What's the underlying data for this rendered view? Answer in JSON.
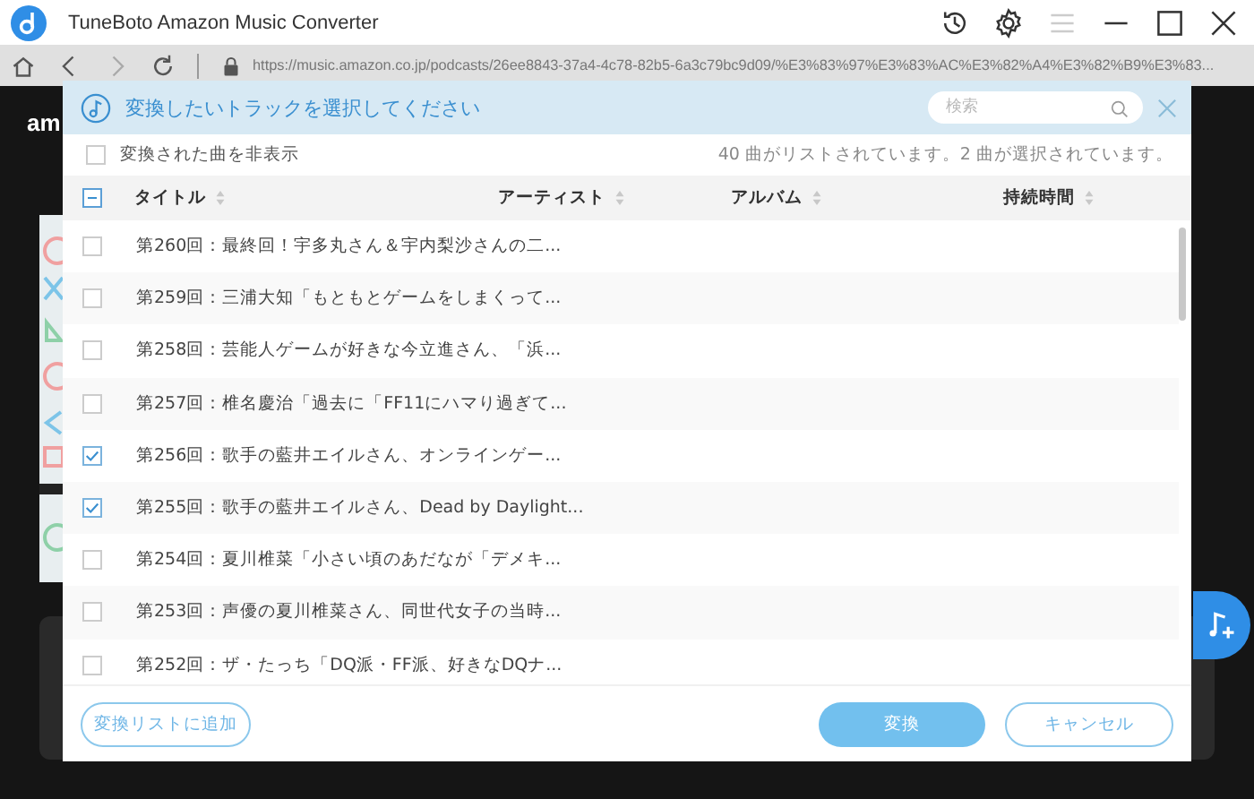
{
  "window": {
    "title": "TuneBoto Amazon Music Converter"
  },
  "address_bar": {
    "url": "https://music.amazon.co.jp/podcasts/26ee8843-37a4-4c78-82b5-6a3c79bc9d09/%E3%83%97%E3%83%AC%E3%82%A4%E3%82%B9%E3%83..."
  },
  "background": {
    "logo": "am"
  },
  "dialog": {
    "title": "変換したいトラックを選択してください",
    "search": {
      "placeholder": "検索"
    },
    "hide_converted": {
      "label": "変換された曲を非表示",
      "checked": false
    },
    "summary": "40 曲がリストされています。2 曲が選択されています。",
    "select_all": {
      "indeterminate": true
    },
    "columns": [
      "タイトル",
      "アーティスト",
      "アルバム",
      "持続時間"
    ],
    "rows": [
      {
        "title": "第260回：最終回！宇多丸さん＆宇内梨沙さんの二...",
        "checked": false
      },
      {
        "title": "第259回：三浦大知「もともとゲームをしまくって...",
        "checked": false
      },
      {
        "title": "第258回：芸能人ゲームが好きな今立進さん、「浜...",
        "checked": false
      },
      {
        "title": "第257回：椎名慶治「過去に「FF11にハマり過ぎて...",
        "checked": false
      },
      {
        "title": "第256回：歌手の藍井エイルさん、オンラインゲー...",
        "checked": true
      },
      {
        "title": "第255回：歌手の藍井エイルさん、Dead by Daylight...",
        "checked": true
      },
      {
        "title": "第254回：夏川椎菜「小さい頃のあだなが「デメキ...",
        "checked": false
      },
      {
        "title": "第253回：声優の夏川椎菜さん、同世代女子の当時...",
        "checked": false
      },
      {
        "title": "第252回：ザ・たっち「DQ派・FF派、好きなDQナ...",
        "checked": false
      }
    ],
    "buttons": [
      {
        "label": "変換リストに追加",
        "kind": "outline"
      },
      {
        "label": "変換",
        "kind": "primary"
      },
      {
        "label": "キャンセル",
        "kind": "outline"
      }
    ]
  }
}
